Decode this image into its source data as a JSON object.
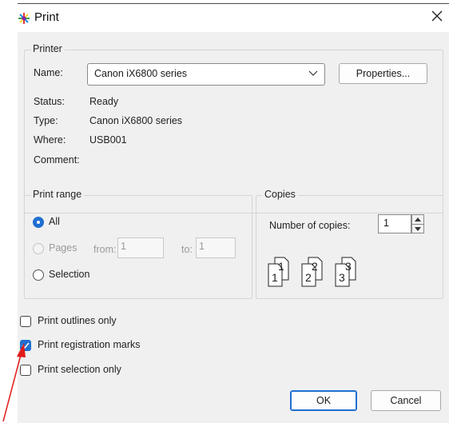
{
  "window": {
    "title": "Print",
    "close_glyph": "✕",
    "icon": "print-app-icon"
  },
  "printer": {
    "group_label": "Printer",
    "name_label": "Name:",
    "name_value": "Canon iX6800 series",
    "properties_label": "Properties...",
    "status_label": "Status:",
    "status_value": "Ready",
    "type_label": "Type:",
    "type_value": "Canon iX6800 series",
    "where_label": "Where:",
    "where_value": "USB001",
    "comment_label": "Comment:"
  },
  "print_range": {
    "group_label": "Print range",
    "all_label": "All",
    "pages_label": "Pages",
    "from_label": "from:",
    "from_value": "1",
    "to_label": "to:",
    "to_value": "1",
    "selection_label": "Selection",
    "selected": "all"
  },
  "copies": {
    "group_label": "Copies",
    "number_label": "Number of copies:",
    "number_value": "1",
    "collate_digits": [
      "1",
      "1",
      "2",
      "2",
      "3",
      "3"
    ]
  },
  "options": {
    "outlines_label": "Print outlines only",
    "outlines_checked": false,
    "registration_label": "Print registration marks",
    "registration_checked": true,
    "selection_only_label": "Print selection only",
    "selection_only_checked": false
  },
  "buttons": {
    "ok": "OK",
    "cancel": "Cancel"
  },
  "colors": {
    "accent": "#1f6fd1",
    "annotation_arrow": "#e01b1b",
    "dialog_bg": "#f0f0f0"
  }
}
